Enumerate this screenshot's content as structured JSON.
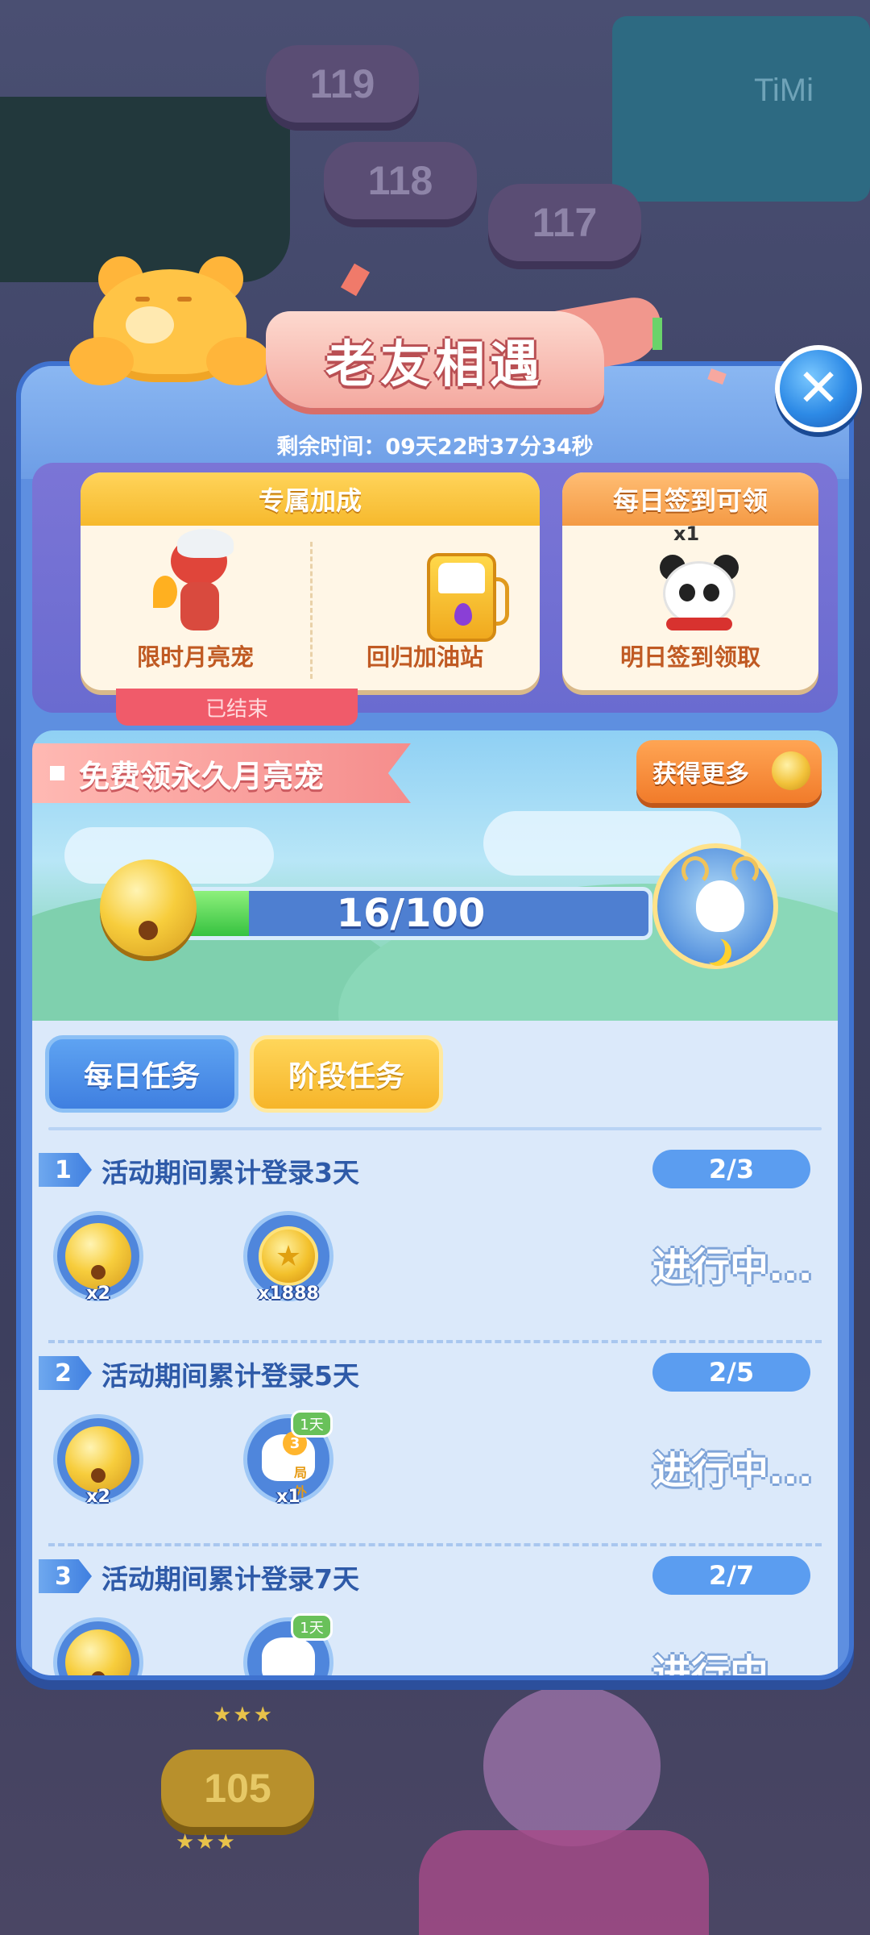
{
  "background": {
    "levels": [
      "119",
      "118",
      "117",
      "105"
    ],
    "sign_text": "TiMi"
  },
  "header": {
    "title": "老友相遇",
    "timer": "剩余时间：09天22时37分34秒"
  },
  "close_button": {
    "icon": "close-icon",
    "symbol": "✕"
  },
  "cards": {
    "exclusive": {
      "title": "专属加成",
      "items": [
        {
          "label": "限时月亮宠",
          "icon": "red-pet-icon"
        },
        {
          "label": "回归加油站",
          "icon": "gas-station-icon"
        }
      ],
      "status": "已结束"
    },
    "daily_sign": {
      "title": "每日签到可领",
      "reward_qty": "x1",
      "label": "明日签到领取",
      "icon": "panda-pet-icon"
    }
  },
  "progress": {
    "banner": "免费领永久月亮宠",
    "more_button": "获得更多",
    "current": 16,
    "total": 100,
    "text": "16/100",
    "reward_icon": "deer-pet-icon"
  },
  "tabs": [
    {
      "label": "每日任务",
      "active": false
    },
    {
      "label": "阶段任务",
      "active": true
    }
  ],
  "tasks": [
    {
      "num": "1",
      "title": "活动期间累计登录3天",
      "progress": "2/3",
      "status": "进行中...",
      "rewards": [
        {
          "type": "bell",
          "qty": "x2"
        },
        {
          "type": "coin",
          "qty": "x1888"
        }
      ]
    },
    {
      "num": "2",
      "title": "活动期间累计登录5天",
      "progress": "2/5",
      "status": "进行中...",
      "rewards": [
        {
          "type": "bell",
          "qty": "x2"
        },
        {
          "type": "glove",
          "qty": "x1",
          "badge": "1天",
          "glove_num": "3",
          "glove_tag": "局外"
        }
      ]
    },
    {
      "num": "3",
      "title": "活动期间累计登录7天",
      "progress": "2/7",
      "status": "进行中...",
      "rewards": [
        {
          "type": "bell",
          "qty": ""
        },
        {
          "type": "glove",
          "qty": "",
          "badge": "1天"
        }
      ]
    }
  ],
  "colors": {
    "panel": "#5e8fe0",
    "accent_orange": "#f17b2a",
    "accent_yellow": "#f6b52a",
    "progress_fill": "#36c240",
    "ended_tag": "#f05b6a"
  }
}
